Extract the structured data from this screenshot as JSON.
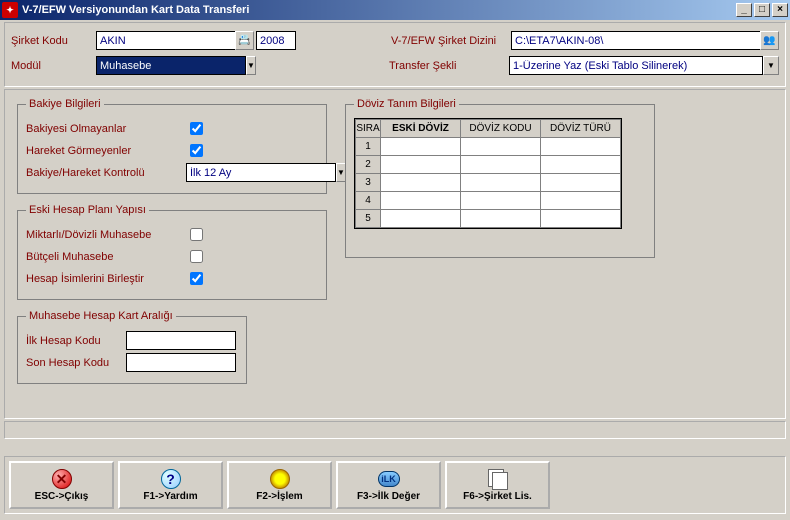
{
  "window": {
    "title": "V-7/EFW Versiyonundan Kart Data Transferi"
  },
  "top": {
    "sirket_kodu_label": "Şirket Kodu",
    "sirket_kodu_value": "AKIN",
    "year": "2008",
    "modul_label": "Modül",
    "modul_value": "Muhasebe",
    "sirket_dizini_label": "V-7/EFW Şirket Dizini",
    "sirket_dizini_value": "C:\\ETA7\\AKIN-08\\",
    "transfer_sekli_label": "Transfer Şekli",
    "transfer_sekli_value": "1-Üzerine Yaz (Eski Tablo Silinerek)"
  },
  "bakiye": {
    "legend": "Bakiye Bilgileri",
    "olmayanlar_label": "Bakiyesi Olmayanlar",
    "gormeyenler_label": "Hareket Görmeyenler",
    "kontrol_label": "Bakiye/Hareket Kontrolü",
    "kontrol_value": "İlk 12 Ay"
  },
  "eski": {
    "legend": "Eski Hesap Planı Yapısı",
    "miktarli_label": "Miktarlı/Dövizli Muhasebe",
    "butceli_label": "Bütçeli Muhasebe",
    "birlestir_label": "Hesap İsimlerini Birleştir"
  },
  "aralik": {
    "legend": "Muhasebe Hesap Kart Aralığı",
    "ilk_label": "İlk Hesap Kodu",
    "son_label": "Son Hesap Kodu",
    "ilk_value": "",
    "son_value": ""
  },
  "doviz": {
    "legend": "Döviz Tanım Bilgileri",
    "headers": {
      "sira": "SIRA",
      "eski": "ESKİ DÖVİZ",
      "kodu": "DÖVİZ KODU",
      "turu": "DÖVİZ TÜRÜ"
    },
    "rows": [
      "1",
      "2",
      "3",
      "4",
      "5"
    ]
  },
  "buttons": {
    "esc": "ESC->Çıkış",
    "f1": "F1->Yardım",
    "f2": "F2->İşlem",
    "f3": "F3->İlk Değer",
    "f6": "F6->Şirket Lis.",
    "ilk_badge": "iLK"
  }
}
